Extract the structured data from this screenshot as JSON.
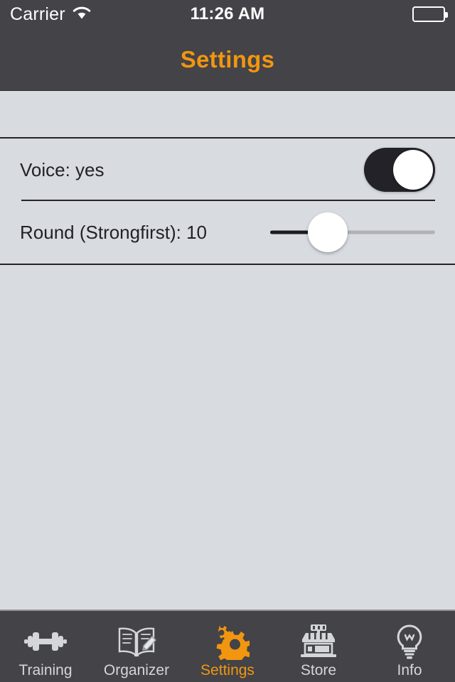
{
  "statusbar": {
    "carrier": "Carrier",
    "wifi_icon": "wifi-icon",
    "time": "11:26 AM",
    "battery_icon": "battery-icon"
  },
  "navbar": {
    "title": "Settings",
    "title_color": "#f2960f",
    "background": "#434348"
  },
  "settings": {
    "rows": [
      {
        "label": "Voice: yes",
        "control": "toggle",
        "toggle_on": true
      },
      {
        "label": "Round (Strongfirst): 10",
        "control": "slider",
        "slider_value": 10,
        "slider_percent": 35
      }
    ]
  },
  "tabbar": {
    "active_index": 2,
    "active_color": "#f2960f",
    "inactive_color": "#d4d6da",
    "background": "#434348",
    "items": [
      {
        "label": "Training",
        "icon": "dumbbell-icon"
      },
      {
        "label": "Organizer",
        "icon": "book-pencil-icon"
      },
      {
        "label": "Settings",
        "icon": "gears-icon"
      },
      {
        "label": "Store",
        "icon": "storefront-icon"
      },
      {
        "label": "Info",
        "icon": "lightbulb-icon"
      }
    ]
  }
}
